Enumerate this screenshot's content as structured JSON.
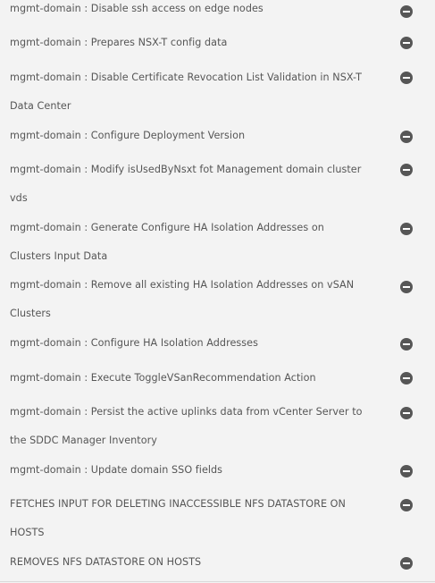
{
  "tasks": [
    {
      "text": "mgmt-domain : Disable ssh access on edge nodes",
      "status_icon": "minus-circle-icon"
    },
    {
      "text": "mgmt-domain : Prepares NSX-T config data",
      "status_icon": "minus-circle-icon"
    },
    {
      "text": "mgmt-domain : Disable Certificate Revocation List Validation in NSX-T Data Center",
      "status_icon": "minus-circle-icon"
    },
    {
      "text": "mgmt-domain : Configure Deployment Version",
      "status_icon": "minus-circle-icon"
    },
    {
      "text": "mgmt-domain : Modify isUsedByNsxt fot Management domain cluster vds",
      "status_icon": "minus-circle-icon"
    },
    {
      "text": "mgmt-domain : Generate Configure HA Isolation Addresses on Clusters Input Data",
      "status_icon": "minus-circle-icon"
    },
    {
      "text": "mgmt-domain : Remove all existing HA Isolation Addresses on vSAN Clusters",
      "status_icon": "minus-circle-icon"
    },
    {
      "text": "mgmt-domain : Configure HA Isolation Addresses",
      "status_icon": "minus-circle-icon"
    },
    {
      "text": "mgmt-domain : Execute ToggleVSanRecommendation Action",
      "status_icon": "minus-circle-icon"
    },
    {
      "text": "mgmt-domain : Persist the active uplinks data from vCenter Server to the SDDC Manager Inventory",
      "status_icon": "minus-circle-icon"
    },
    {
      "text": "mgmt-domain : Update domain SSO fields",
      "status_icon": "minus-circle-icon"
    },
    {
      "text": "FETCHES INPUT FOR DELETING INACCESSIBLE NFS DATASTORE ON HOSTS",
      "status_icon": "minus-circle-icon"
    },
    {
      "text": "REMOVES NFS DATASTORE ON HOSTS",
      "status_icon": "minus-circle-icon"
    }
  ]
}
